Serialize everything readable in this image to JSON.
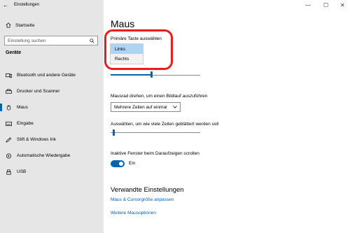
{
  "window": {
    "title": "Einstellungen",
    "controls": {
      "minimize": "—",
      "maximize": "☐",
      "close": "✕"
    }
  },
  "sidebar": {
    "home_label": "Startseite",
    "search_placeholder": "Einstellung suchen",
    "section_title": "Geräte",
    "items": [
      {
        "label": "Bluetooth und andere Geräte",
        "icon": "bluetooth-icon"
      },
      {
        "label": "Drucker und Scanner",
        "icon": "printer-icon"
      },
      {
        "label": "Maus",
        "icon": "mouse-icon",
        "active": true
      },
      {
        "label": "Eingabe",
        "icon": "keyboard-icon"
      },
      {
        "label": "Stift & Windows Ink",
        "icon": "pen-icon"
      },
      {
        "label": "Automatische Wiedergabe",
        "icon": "autoplay-icon"
      },
      {
        "label": "USB",
        "icon": "usb-icon"
      }
    ]
  },
  "main": {
    "title": "Maus",
    "primary_button": {
      "label": "Primäre Taste auswählen",
      "options": [
        "Links",
        "Rechts"
      ],
      "selected": "Links"
    },
    "scroll_mode": {
      "label": "Mausrad drehen, um einen Bildlauf auszuführen",
      "value": "Mehrere Zeilen auf einmal"
    },
    "cursor_speed_fraction": 0.45,
    "lines_scroll": {
      "label": "Auswählen, um wie viele Zeilen geblättert werden soll",
      "fraction": 0.02
    },
    "inactive_scroll": {
      "label": "Inaktive Fenster beim Daraufzeigen scrollen",
      "state": "Ein",
      "on": true
    },
    "related": {
      "title": "Verwandte Einstellungen",
      "links": [
        "Maus & Cursorgröße anpassen",
        "Weitere Mausoptionen"
      ]
    }
  },
  "colors": {
    "accent": "#0063b1",
    "highlight": "#ea1c1c",
    "sidebar_bg": "#e6e6e6"
  }
}
